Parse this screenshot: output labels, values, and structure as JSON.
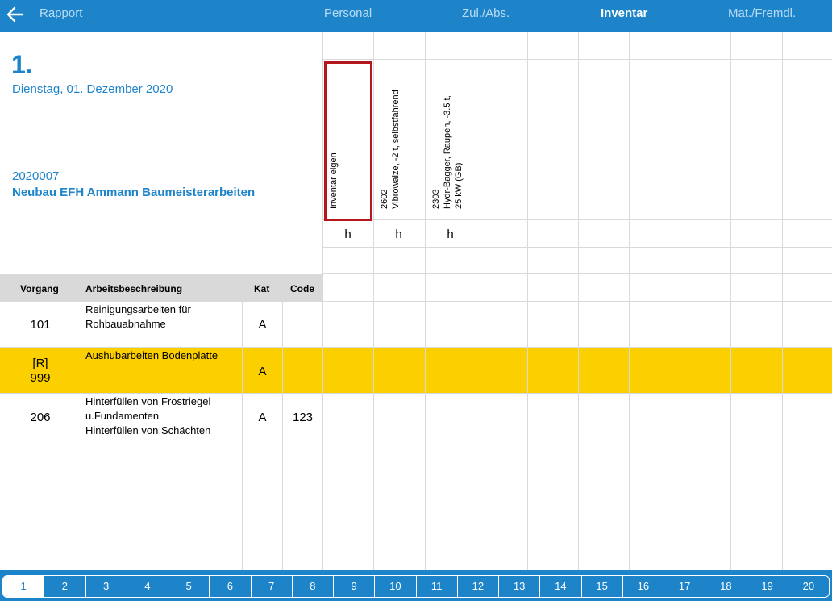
{
  "topbar": {
    "back_label": "Rapport",
    "tabs": [
      "Personal",
      "Zul./Abs.",
      "Inventar",
      "Mat./Fremdl."
    ],
    "active_tab": "Inventar"
  },
  "header": {
    "day_number": "1.",
    "date": "Dienstag, 01. Dezember 2020",
    "project_no": "2020007",
    "project_name": "Neubau EFH Ammann Baumeisterarbeiten"
  },
  "inventory_columns": [
    {
      "lines": [
        "Inventar eigen"
      ],
      "unit": "h",
      "selected": true
    },
    {
      "lines": [
        "2602",
        "Vibrowalze, -2 t, selbstfahrend"
      ],
      "unit": "h"
    },
    {
      "lines": [
        "2303",
        "Hydr-Bagger, Raupen, -3.5 t,",
        "25 kW (GB)"
      ],
      "unit": "h"
    }
  ],
  "table": {
    "headers": {
      "vorgang": "Vorgang",
      "beschreibung": "Arbeitsbeschreibung",
      "kat": "Kat",
      "code": "Code"
    },
    "rows": [
      {
        "vorgang": [
          "101"
        ],
        "beschreibung": [
          "Reinigungsarbeiten für",
          "Rohbauabnahme"
        ],
        "kat": "A",
        "code": ""
      },
      {
        "vorgang": [
          "[R]",
          "999"
        ],
        "beschreibung": [
          "Aushubarbeiten Bodenplatte"
        ],
        "kat": "A",
        "code": "",
        "highlighted": true
      },
      {
        "vorgang": [
          "206"
        ],
        "beschreibung": [
          "Hinterfüllen von Frostriegel",
          "u.Fundamenten",
          "Hinterfüllen von Schächten"
        ],
        "kat": "A",
        "code": "123"
      }
    ]
  },
  "pager": {
    "pages": [
      "1",
      "2",
      "3",
      "4",
      "5",
      "6",
      "7",
      "8",
      "9",
      "10",
      "11",
      "12",
      "13",
      "14",
      "15",
      "16",
      "17",
      "18",
      "19",
      "20"
    ],
    "active": "1"
  },
  "colors": {
    "accent": "#1d84c9",
    "highlight": "#fcd000",
    "selection": "#b3161c"
  }
}
